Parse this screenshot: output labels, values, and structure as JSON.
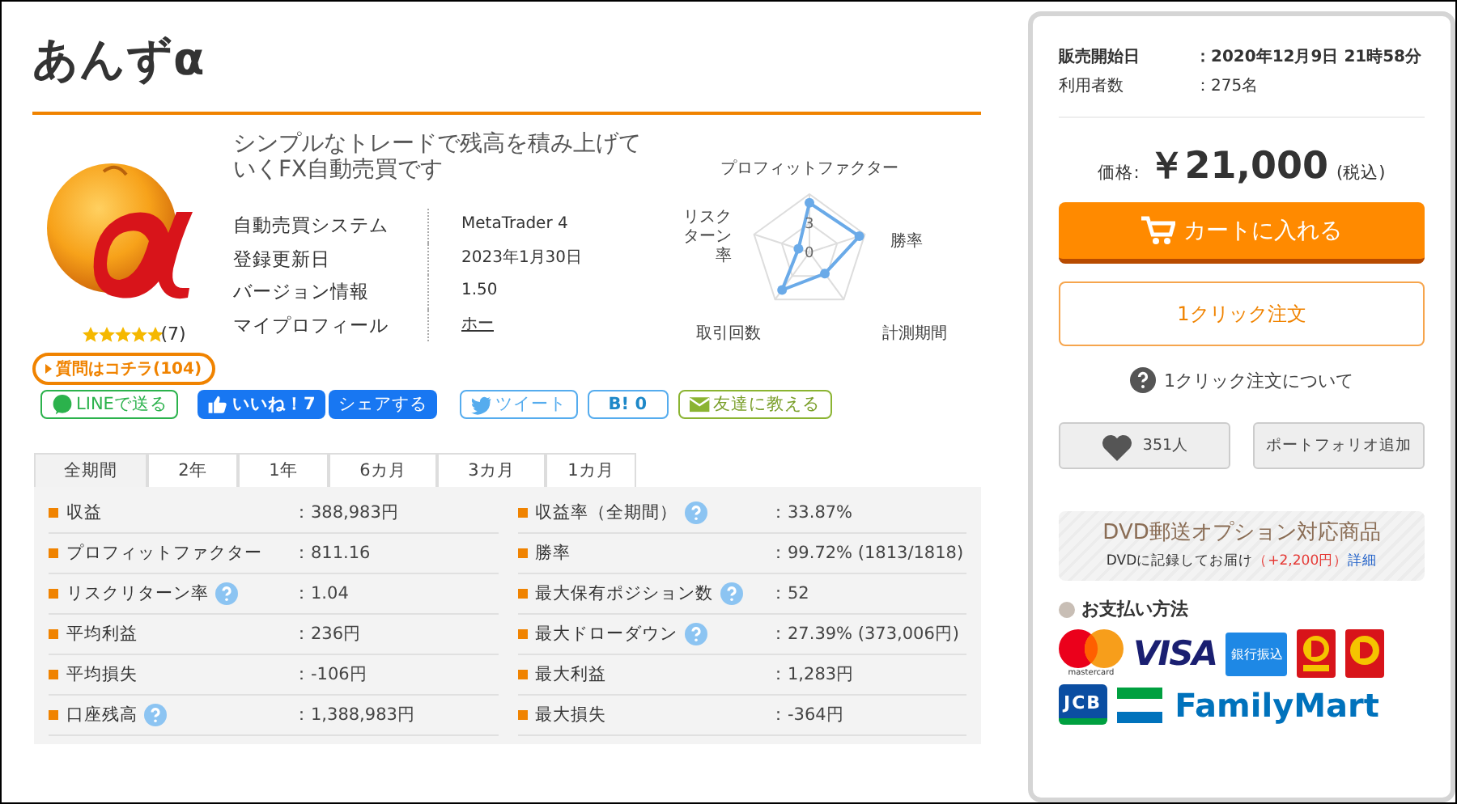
{
  "product": {
    "title": "あんずα",
    "description": "シンプルなトレードで残高を積み上げていくFX自動売買です",
    "stars": 5,
    "review_count": "(7)",
    "question_link": "質問はコチラ(104)",
    "info": [
      {
        "label": "自動売買システム",
        "value": "MetaTrader 4",
        "kind": "text"
      },
      {
        "label": "登録更新日",
        "value": "2023年1月30日",
        "kind": "text"
      },
      {
        "label": "バージョン情報",
        "value": "1.50",
        "kind": "text"
      },
      {
        "label": "マイプロフィール",
        "value": "ホー",
        "kind": "link"
      }
    ],
    "radar": {
      "axes": [
        "プロフィットファクター",
        "リスクターン率",
        "勝率",
        "取引回数",
        "計測期間"
      ],
      "ticks": [
        "3",
        "0"
      ]
    }
  },
  "share_buttons": [
    {
      "kind": "line",
      "label": "LINEで送る"
    },
    {
      "kind": "like",
      "label": "いいね！7"
    },
    {
      "kind": "share",
      "label": "シェアする"
    },
    {
      "kind": "tweet",
      "label": "ツイート"
    },
    {
      "kind": "hatena",
      "label": "B! 0"
    },
    {
      "kind": "mail",
      "label": "友達に教える"
    }
  ],
  "tabs": [
    {
      "label": "全期間",
      "selected": true
    },
    {
      "label": "2年",
      "selected": false
    },
    {
      "label": "1年",
      "selected": false
    },
    {
      "label": "6カ月",
      "selected": false
    },
    {
      "label": "3カ月",
      "selected": false
    },
    {
      "label": "1カ月",
      "selected": false
    }
  ],
  "stats": [
    [
      {
        "label": "収益",
        "help": false,
        "value": "：388,983円"
      },
      {
        "label": "プロフィットファクター",
        "help": false,
        "value": "：811.16"
      },
      {
        "label": "リスクリターン率",
        "help": true,
        "value": "：1.04"
      },
      {
        "label": "平均利益",
        "help": false,
        "value": "：236円"
      },
      {
        "label": "平均損失",
        "help": false,
        "value": "：-106円"
      },
      {
        "label": "口座残高",
        "help": true,
        "value": "：1,388,983円"
      }
    ],
    [
      {
        "label": "収益率（全期間）",
        "help": true,
        "value": "：33.87%"
      },
      {
        "label": "勝率",
        "help": false,
        "value": "：99.72% (1813/1818)"
      },
      {
        "label": "最大保有ポジション数",
        "help": true,
        "value": "：52"
      },
      {
        "label": "最大ドローダウン",
        "help": true,
        "value": "：27.39% (373,006円)"
      },
      {
        "label": "最大利益",
        "help": false,
        "value": "：1,283円"
      },
      {
        "label": "最大損失",
        "help": false,
        "value": "：-364円"
      }
    ]
  ],
  "purchase": {
    "meta": [
      {
        "label": "販売開始日",
        "value": "：2020年12月9日 21時58分",
        "bold": true
      },
      {
        "label": "利用者数",
        "value": "：275名",
        "bold": false
      }
    ],
    "price_label": "価格:",
    "price": "￥21,000",
    "tax_note": "(税込)",
    "cart_button": "カートに入れる",
    "one_click_button": "1クリック注文",
    "one_click_help": "1クリック注文について",
    "favorite_count": "351人",
    "portfolio_button": "ポートフォリオ追加",
    "dvd": {
      "title": "DVD郵送オプション対応商品",
      "text": "DVDに記録してお届け",
      "price_note": "（+2,200円）",
      "link": "詳細"
    },
    "payment_heading": "お支払い方法",
    "payment_methods": [
      {
        "kind": "mastercard",
        "label": "mastercard"
      },
      {
        "kind": "visa",
        "label": "VISA"
      },
      {
        "kind": "bank",
        "label": "銀行振込"
      },
      {
        "kind": "daily_red"
      },
      {
        "kind": "daily"
      },
      {
        "kind": "jcb",
        "label": "JCB"
      },
      {
        "kind": "familymart",
        "label": "FamilyMart"
      }
    ]
  }
}
